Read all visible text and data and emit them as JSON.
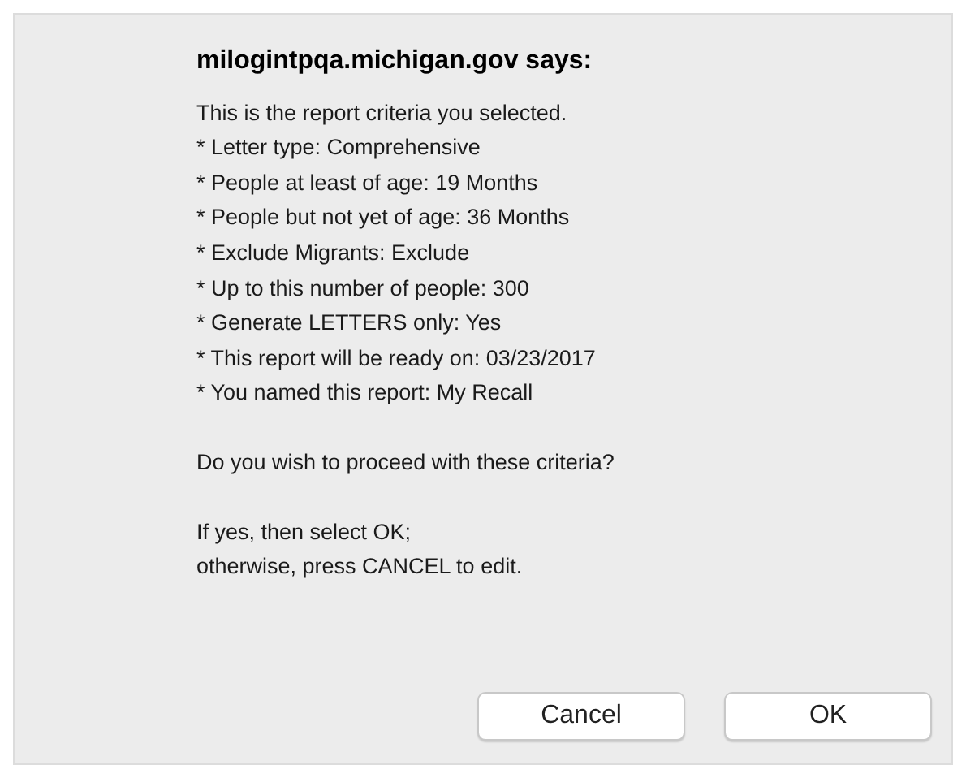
{
  "dialog": {
    "title": "milogintpqa.michigan.gov says:",
    "intro": "This is the report criteria you selected.",
    "criteria": [
      "* Letter type: Comprehensive",
      "* People at least of age: 19 Months",
      "* People but not yet of age: 36 Months",
      "* Exclude Migrants: Exclude",
      "* Up to this number of people: 300",
      "* Generate LETTERS only: Yes",
      "* This report will be ready on: 03/23/2017",
      "* You named this report: My Recall"
    ],
    "question": "Do you wish to proceed with these criteria?",
    "instructions": [
      "If yes, then select OK;",
      "otherwise, press CANCEL to edit."
    ],
    "buttons": [
      "Cancel",
      "OK"
    ]
  }
}
